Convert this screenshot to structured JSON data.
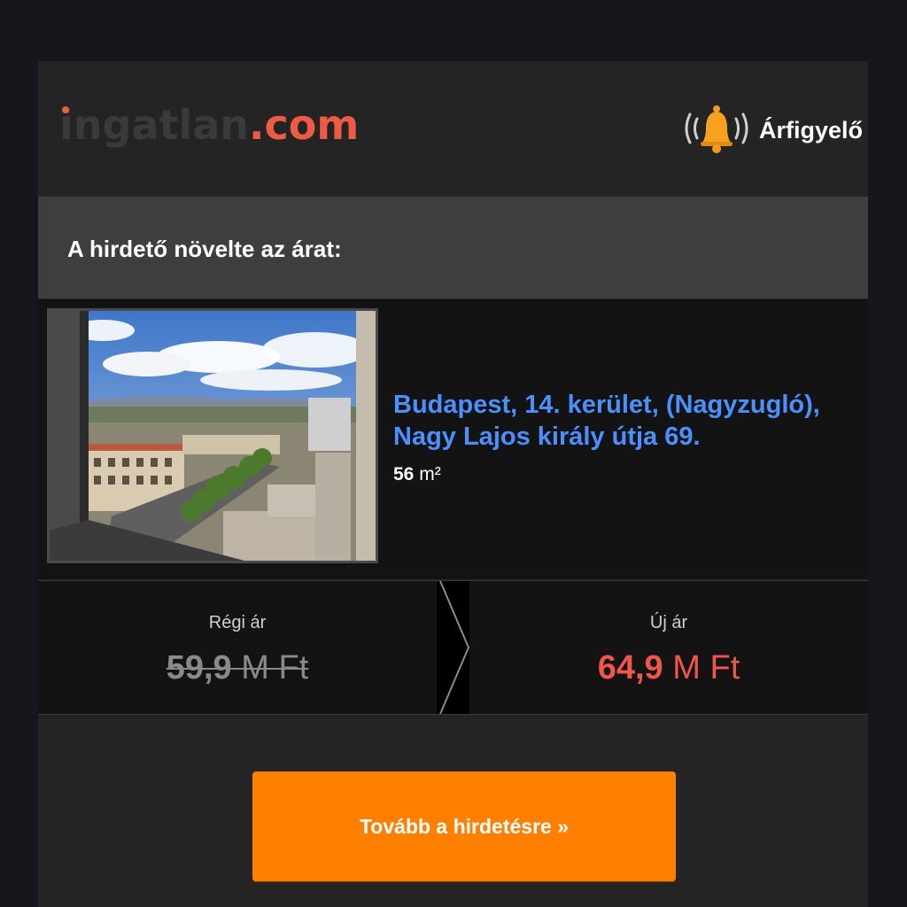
{
  "header": {
    "logo": {
      "brand": "ingatlan",
      "dot": ".",
      "tld": "com"
    },
    "price_watch_label": "Árfigyelő",
    "price_watch_icon": "bell-ringing-icon"
  },
  "notice": {
    "title": "A hirdető növelte az árat:"
  },
  "listing": {
    "address_line1": "Budapest, 14. kerület, (Nagyzugló),",
    "address_line2": "Nagy Lajos király útja 69.",
    "size_value": "56",
    "size_unit": "m²",
    "photo_description_icon": "city-view-photo"
  },
  "prices": {
    "old_label": "Régi ár",
    "old_value": "59,9",
    "old_unit": "M Ft",
    "new_label": "Új ár",
    "new_value": "64,9",
    "new_unit": "M Ft"
  },
  "cta": {
    "label": "Tovább a hirdetésre »"
  },
  "colors": {
    "page_bg": "#16171c",
    "card_bg": "#242424",
    "subhead_bg": "#3e3e3e",
    "listing_bg": "#131313",
    "link_blue": "#4a90ff",
    "brand_red": "#ef5a45",
    "new_price_red": "#f0564a",
    "cta_orange": "#ff8000"
  }
}
